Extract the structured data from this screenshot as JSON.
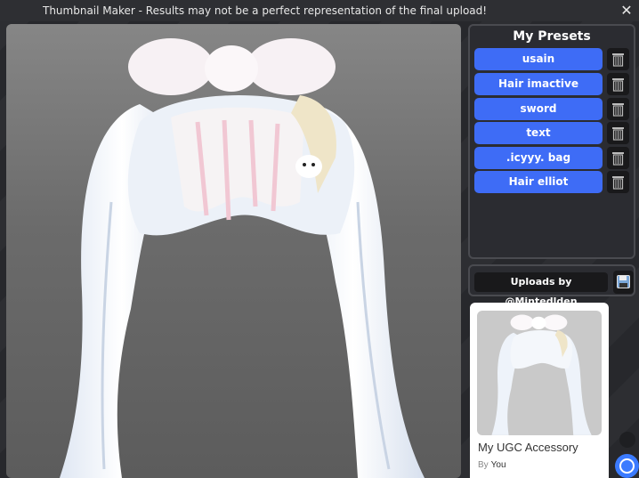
{
  "window": {
    "title": "Thumbnail Maker - Results may not be a perfect representation of the final upload!",
    "close_glyph": "✕"
  },
  "presets": {
    "heading": "My Presets",
    "items": [
      {
        "label": "usain"
      },
      {
        "label": "Hair imactive"
      },
      {
        "label": "sword"
      },
      {
        "label": "text"
      },
      {
        "label": ".icyyy. bag"
      },
      {
        "label": "Hair elliot"
      }
    ],
    "delete_icon": "trash-icon",
    "button_color": "#3e6cf6"
  },
  "uploads": {
    "label": "Uploads by @Mintedlden",
    "save_icon": "floppy-disk-icon"
  },
  "card": {
    "name": "My UGC Accessory",
    "by_label": "By",
    "by_user": "You"
  },
  "colors": {
    "accent": "#3b7bff",
    "panel_bg": "#2b2c31"
  }
}
